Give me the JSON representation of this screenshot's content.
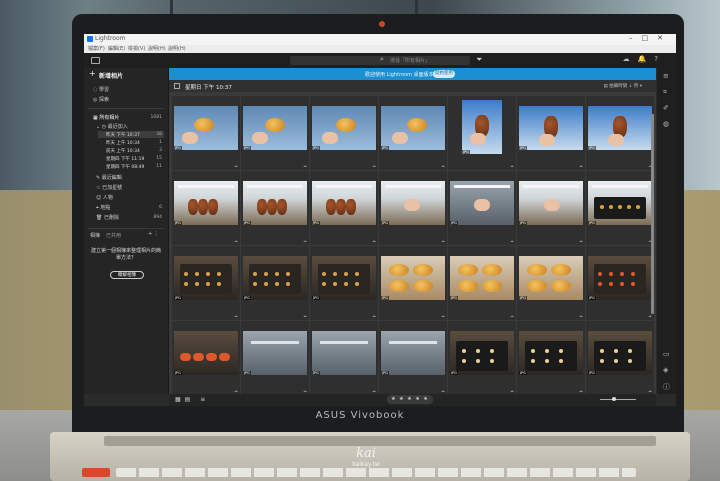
{
  "window": {
    "title": "Lightroom",
    "menus": [
      "檔案(F)",
      "編輯(E)",
      "檢視(V)",
      "說明(H)",
      "說明(H)"
    ]
  },
  "toolbar": {
    "search_placeholder": "搜尋「所有相片」"
  },
  "left_panel": {
    "new_album": "新增相片",
    "nav": [
      {
        "label": "學習",
        "icon": "bulb-icon"
      },
      {
        "label": "探索",
        "icon": "compass-icon"
      }
    ],
    "all_photos": {
      "label": "所有相片",
      "count": "1081"
    },
    "recently_added": {
      "label": "最近加入",
      "icon": "clock-icon"
    },
    "recent_items": [
      {
        "label": "昨天 下午 10:37",
        "count": "38"
      },
      {
        "label": "昨天 上午 10:34",
        "count": "1"
      },
      {
        "label": "前天 上午 10:34",
        "count": "3"
      },
      {
        "label": "星期四 下午 11:19",
        "count": "15"
      },
      {
        "label": "星期四 下午 08:49",
        "count": "11"
      }
    ],
    "more_nav": [
      {
        "label": "最近編輯",
        "icon": "pencil-icon",
        "count": ""
      },
      {
        "label": "已加星號",
        "icon": "star-icon",
        "count": ""
      },
      {
        "label": "人物",
        "icon": "person-icon",
        "count": ""
      },
      {
        "label": "地點",
        "icon": "pin-icon",
        "count": "6"
      },
      {
        "label": "已刪除",
        "icon": "trash-icon",
        "count": "894"
      }
    ],
    "tabs": [
      "相簿",
      "已共用"
    ],
    "prompt": "建立第一個相簿來整理相片的簡單方法？",
    "learn_button": "瞭解相簿"
  },
  "main": {
    "banner_text": "歡迎使用 Lightroom 桌面版本",
    "banner_button": "開始使用",
    "date_header": "星期日 下午 10:37",
    "sort_label": "▤ 拍攝時間 ↓ 所 ▾",
    "rows": 4,
    "columns": 7,
    "file_badge": "JPG"
  },
  "bottombar": {
    "rating": "★ ★ ★ ★ ★"
  },
  "laptop": {
    "brand": "ASUS Vivobook"
  },
  "watermark": {
    "logo": "kai",
    "url": "kaikay.tw"
  },
  "colors": {
    "banner": "#1b8fd2",
    "app_accent": "#1473e6",
    "panel_bg": "#252525",
    "grid_bg": "#3a3a3a"
  }
}
